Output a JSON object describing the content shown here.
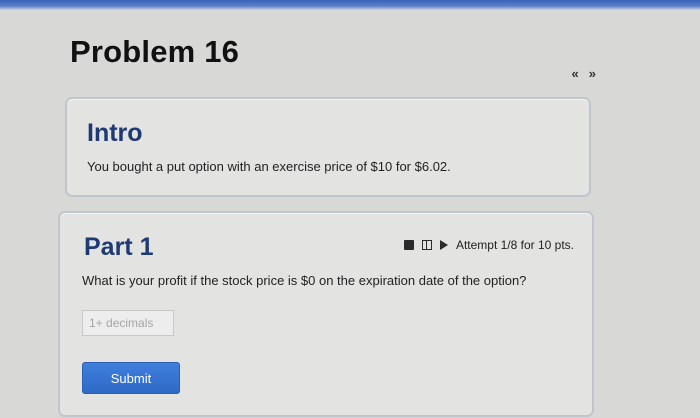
{
  "problem": {
    "title": "Problem 16",
    "nav": {
      "prev_icon": "«",
      "next_icon": "»"
    }
  },
  "intro": {
    "heading": "Intro",
    "text": "You bought a put option with an exercise price of $10 for $6.02."
  },
  "part1": {
    "heading": "Part 1",
    "attempt": "Attempt 1/8 for 10 pts.",
    "question": "What is your profit if the stock price is $0 on the expiration date of the option?",
    "input": {
      "value": "",
      "placeholder": "1+ decimals"
    },
    "submit_label": "Submit"
  },
  "colors": {
    "heading": "#1f3a72",
    "submit": "#3474d2",
    "top_band": "#3a63b8"
  }
}
